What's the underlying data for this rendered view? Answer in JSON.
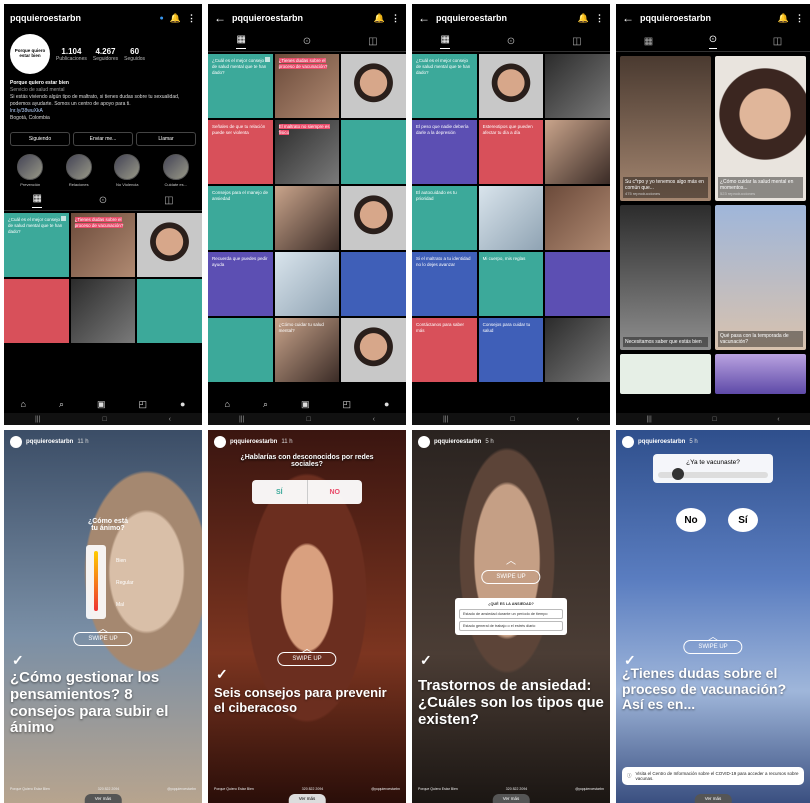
{
  "username": "pqquieroestarbn",
  "profile": {
    "avatar_text": "Porque quiero estar bien",
    "posts": "1.104",
    "posts_label": "Publicaciones",
    "followers": "4.267",
    "followers_label": "Seguidores",
    "following": "60",
    "following_label": "Seguidos",
    "name": "Porque quiero estar bien",
    "category": "Servicio de salud mental",
    "bio": "Si estás viviendo algún tipo de maltrato, si tienes dudas sobre tu sexualidad, podemos ayudarte. Somos un centro de apoyo para ti.",
    "link": "lnr.ly/38wuXkA",
    "location": "Bogotá, Colombia",
    "btn_following": "Siguiendo",
    "btn_message": "Enviar me...",
    "btn_call": "Llamar",
    "highlights": [
      "Prevención",
      "Relaciones",
      "No Violencia",
      "Cuidate es..."
    ]
  },
  "grid_texts": {
    "g1": "¿Cuál es el mejor consejo de salud mental que te han dado?",
    "g2": "¿Tienes dudas sobre el proceso de vacunación?",
    "g3": "Señales de que tu relación puede ser violenta",
    "g4": "El maltrato no siempre es físico",
    "g5": "Consejos para el manejo de ansiedad",
    "g6": "Recuerda que puedes pedir ayuda",
    "g7": "¿Cómo cuidar tu salud mental?",
    "g8": "Mi cuerpo, mis reglas",
    "g9": "El autocuidado es tu prioridad",
    "g10": "Estereotipos que pueden afectar tu día a día",
    "g11": "Si el maltrato a tu identidad no lo dejes avanzar",
    "g12": "Contáctanos para saber más",
    "g13": "El peso que nadie debería darle a la depresión",
    "g14": "Consejos para cuidar tu salud"
  },
  "reels": {
    "r1": "Su c*rpo y yo tenemos algo más en común que...",
    "r2": "¿Cómo cuidar la salud mental en momentos...",
    "r3": "Necesitamos saber que estás bien",
    "r4": "Qué pasa con la temporada de vacunación?",
    "views1": "475 reproducciones",
    "views2": "523 reproducciones"
  },
  "stories": {
    "s1_title": "¿Cómo gestionar los pensamientos? 8 consejos para subir el ánimo",
    "s1_question": "¿Cómo está tu ánimo?",
    "s1_opts": [
      "Bien",
      "Regular",
      "Mal"
    ],
    "s2_question": "¿Hablarías con desconocidos por redes sociales?",
    "s2_yes": "SÍ",
    "s2_no": "NO",
    "s2_title": "Seis consejos para prevenir el ciberacoso",
    "s3_title": "Trastornos de ansiedad: ¿Cuáles son los tipos que existen?",
    "s3_quiz_q": "¿QUÉ ES LA ANSIEDAD?",
    "s3_quiz_opts": [
      "Estado de ansiedad durante un período de tiempo",
      "Estado general de trabajo o el estrés diario"
    ],
    "s4_question": "¿Ya te vacunaste?",
    "s4_no": "No",
    "s4_yes": "Sí",
    "s4_title": "¿Tienes dudas sobre el proceso de vacunación? Así es en...",
    "s4_banner": "Visita el Centro de Información sobre el COVID-19 para acceder a recursos sobre vacunas.",
    "swipe": "SWIPE UP",
    "ver_mas": "Ver más",
    "foot_a": "Porque Quiero Estar Bien",
    "foot_b": "320 822 2094",
    "foot_c": "@pqquieroestarbn",
    "time1": "11 h",
    "time2": "5 h"
  },
  "colors": {
    "teal": "#3ca99a",
    "red": "#d8505a",
    "purple": "#5c4fb3",
    "verified": "#3897f0"
  }
}
